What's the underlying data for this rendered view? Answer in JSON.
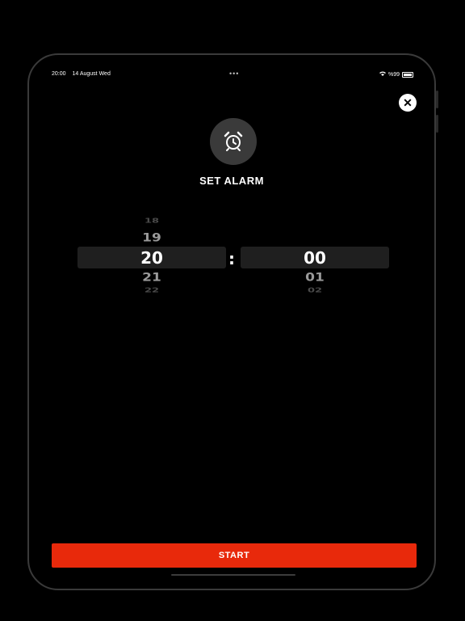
{
  "status_bar": {
    "time": "20:00",
    "date": "14 August Wed",
    "dots": "•••",
    "battery": "%99"
  },
  "close": {
    "icon": "close-icon",
    "glyph": "✕"
  },
  "title": "SET ALARM",
  "picker": {
    "hours": [
      "18",
      "19",
      "20",
      "21",
      "22"
    ],
    "minutes": [
      "00",
      "01",
      "02"
    ],
    "separator": ":"
  },
  "start_label": "START",
  "colors": {
    "accent": "#e8290b",
    "highlight": "#1f1f1f",
    "icon_bg": "#3a3a3a"
  }
}
